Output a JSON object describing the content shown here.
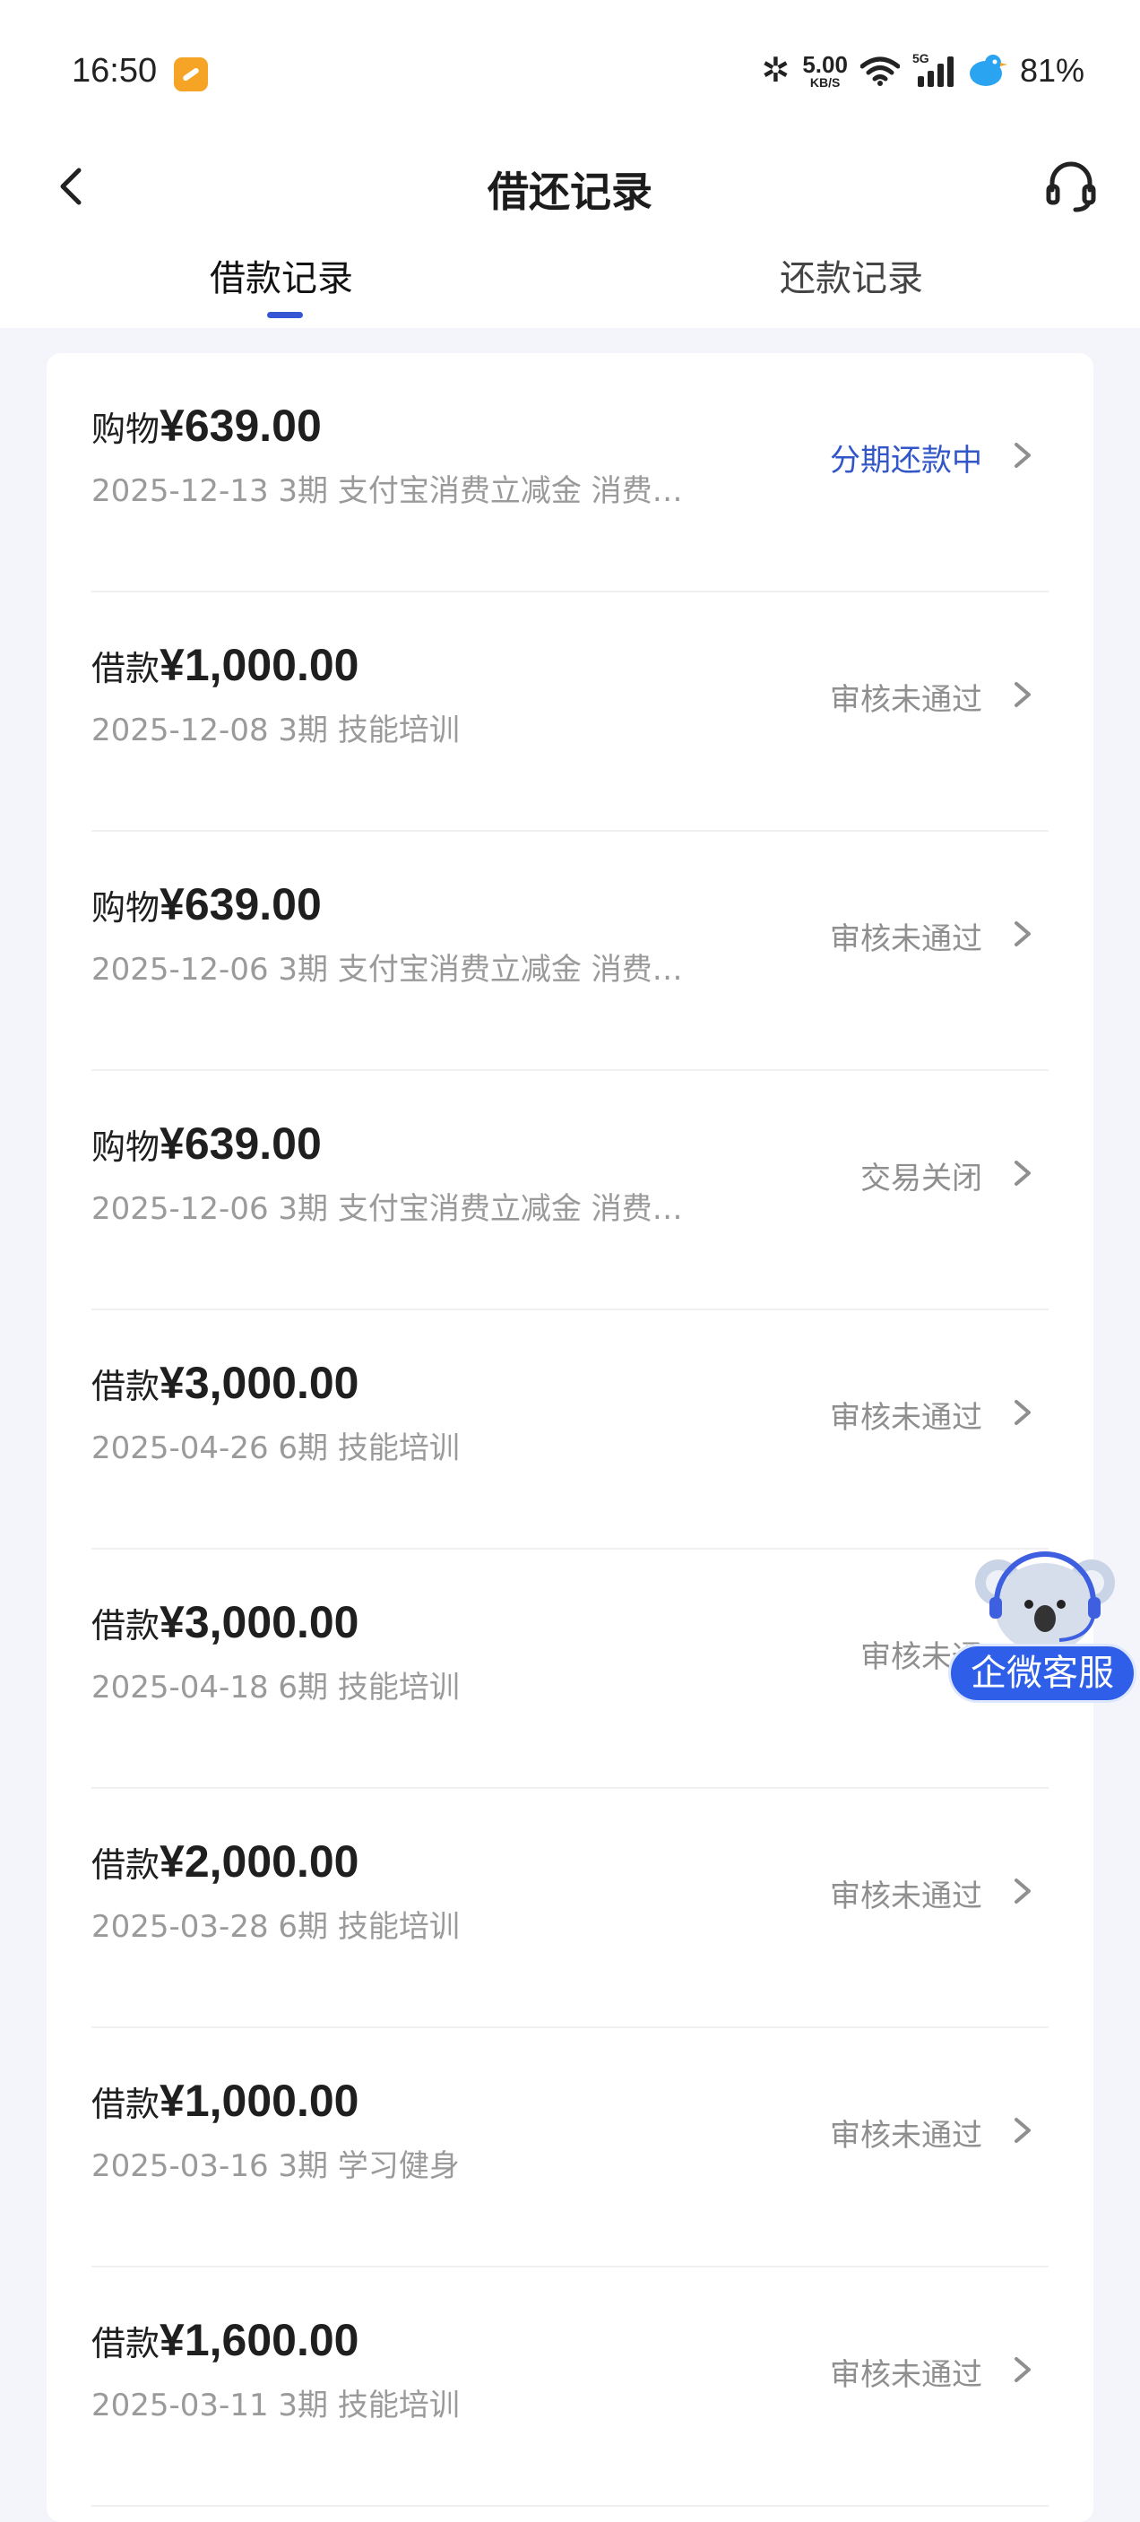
{
  "status_bar": {
    "time": "16:50",
    "net_speed_value": "5.00",
    "net_speed_unit": "KB/S",
    "signal_tag": "5G",
    "battery": "81%"
  },
  "header": {
    "title": "借还记录",
    "back_icon": "chevron-left-icon",
    "support_icon": "headset-icon"
  },
  "tabs": [
    {
      "label": "借款记录",
      "active": true
    },
    {
      "label": "还款记录",
      "active": false
    }
  ],
  "records": [
    {
      "type": "购物",
      "amount": "¥639.00",
      "subtitle": "2025-12-13 3期  支付宝消费立减金 消费…",
      "status": "分期还款中",
      "status_color": "#3256c8"
    },
    {
      "type": "借款",
      "amount": "¥1,000.00",
      "subtitle": "2025-12-08 3期  技能培训",
      "status": "审核未通过",
      "status_color": "#8f8f8f"
    },
    {
      "type": "购物",
      "amount": "¥639.00",
      "subtitle": "2025-12-06 3期  支付宝消费立减金 消费…",
      "status": "审核未通过",
      "status_color": "#8f8f8f"
    },
    {
      "type": "购物",
      "amount": "¥639.00",
      "subtitle": "2025-12-06 3期  支付宝消费立减金 消费…",
      "status": "交易关闭",
      "status_color": "#8f8f8f"
    },
    {
      "type": "借款",
      "amount": "¥3,000.00",
      "subtitle": "2025-04-26 6期  技能培训",
      "status": "审核未通过",
      "status_color": "#8f8f8f"
    },
    {
      "type": "借款",
      "amount": "¥3,000.00",
      "subtitle": "2025-04-18 6期  技能培训",
      "status": "审核未通",
      "status_color": "#8f8f8f"
    },
    {
      "type": "借款",
      "amount": "¥2,000.00",
      "subtitle": "2025-03-28 6期  技能培训",
      "status": "审核未通过",
      "status_color": "#8f8f8f"
    },
    {
      "type": "借款",
      "amount": "¥1,000.00",
      "subtitle": "2025-03-16 3期  学习健身",
      "status": "审核未通过",
      "status_color": "#8f8f8f"
    },
    {
      "type": "借款",
      "amount": "¥1,600.00",
      "subtitle": "2025-03-11 3期  技能培训",
      "status": "审核未通过",
      "status_color": "#8f8f8f"
    }
  ],
  "floating_service": {
    "label": "企微客服",
    "icon": "koala-mascot-icon"
  },
  "colors": {
    "accent": "#3656d6",
    "pill": "#2f5fe8",
    "muted_text": "#9a9a9a"
  }
}
